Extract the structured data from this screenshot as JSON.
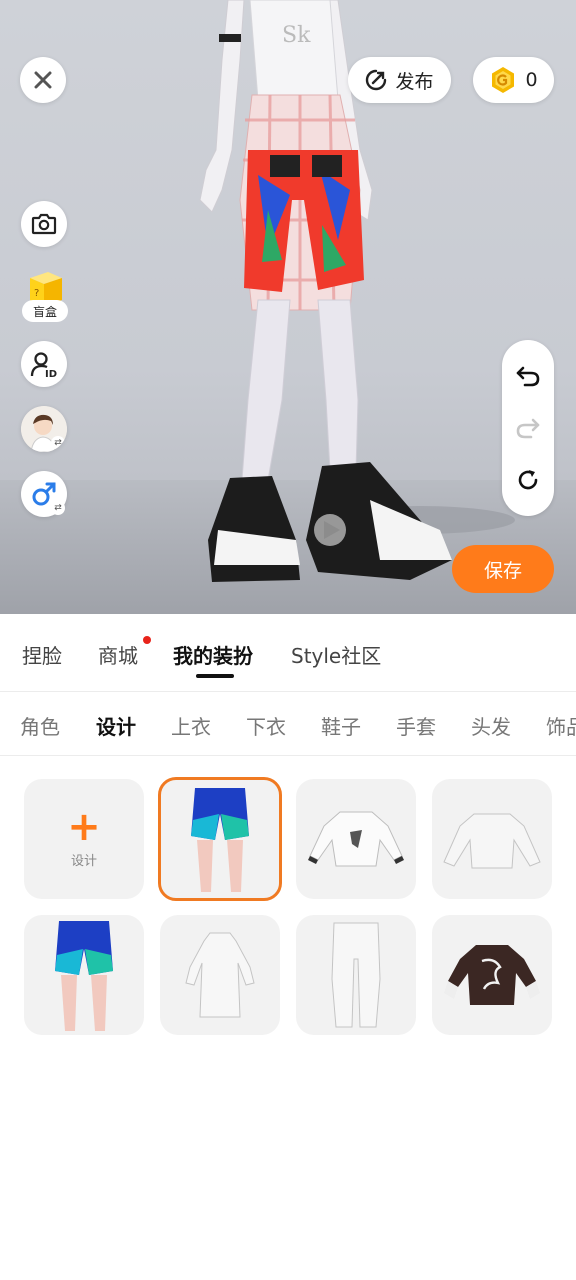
{
  "header": {
    "publish_label": "发布",
    "coin_count": "0"
  },
  "left_tools": {
    "blindbox_label": "盲盒"
  },
  "save_label": "保存",
  "main_tabs": [
    {
      "label": "捏脸",
      "active": false,
      "has_dot": false
    },
    {
      "label": "商城",
      "active": false,
      "has_dot": true
    },
    {
      "label": "我的装扮",
      "active": true,
      "has_dot": false
    },
    {
      "label": "Style社区",
      "active": false,
      "has_dot": false
    }
  ],
  "sub_tabs": [
    {
      "label": "角色",
      "active": false
    },
    {
      "label": "设计",
      "active": true
    },
    {
      "label": "上衣",
      "active": false
    },
    {
      "label": "下衣",
      "active": false
    },
    {
      "label": "鞋子",
      "active": false
    },
    {
      "label": "手套",
      "active": false
    },
    {
      "label": "头发",
      "active": false
    },
    {
      "label": "饰品",
      "active": false
    }
  ],
  "design_tile": {
    "plus": "+",
    "label": "设计"
  },
  "items": [
    {
      "icon": "blue-shorts-icon",
      "selected": true
    },
    {
      "icon": "white-tshirt-icon",
      "selected": false
    },
    {
      "icon": "white-sweatshirt-icon",
      "selected": false
    },
    {
      "icon": "blue-shorts-icon",
      "selected": false
    },
    {
      "icon": "white-hoodie-icon",
      "selected": false
    },
    {
      "icon": "white-pants-icon",
      "selected": false
    },
    {
      "icon": "brown-tshirt-icon",
      "selected": false
    }
  ],
  "colors": {
    "accent": "#ff7b1a",
    "selected_border": "#f07a22",
    "notification_dot": "#e8231a",
    "coin": "#f5b800"
  }
}
